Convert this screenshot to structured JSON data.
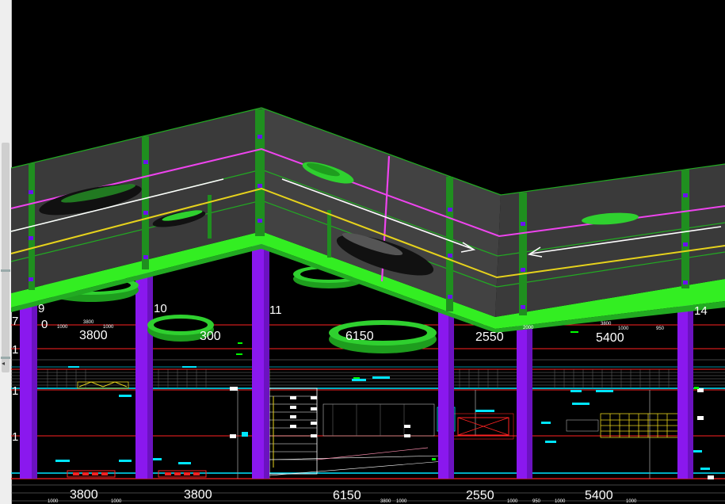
{
  "dimensions": {
    "upper": [
      "3800",
      "300",
      "6150",
      "2550",
      "5400"
    ],
    "bottom": [
      "3800",
      "3800",
      "6150",
      "2550",
      "5400"
    ]
  },
  "grid_axes": [
    "9",
    "10",
    "11",
    "14"
  ],
  "left_markers": [
    "7",
    "0",
    "1",
    "1",
    "1"
  ],
  "small_dims": [
    "1000",
    "1000",
    "3800",
    "2000",
    "3800",
    "1000",
    "950",
    "1000",
    "1000",
    "3800",
    "1000",
    "1000",
    "1000",
    "1000",
    "950"
  ],
  "colors": {
    "background": "#000000",
    "roof_panel": "#3a3a3a",
    "frame_green": "#22aa22",
    "slab_green": "#33ee22",
    "column": "#8a18ee",
    "magenta": "#ee44ee",
    "yellow": "#e6d21c",
    "cad_line": "#ff2222",
    "cad_cyan": "#00e5ff"
  },
  "icons": [
    "arrow-right-icon",
    "arrow-left-icon"
  ]
}
